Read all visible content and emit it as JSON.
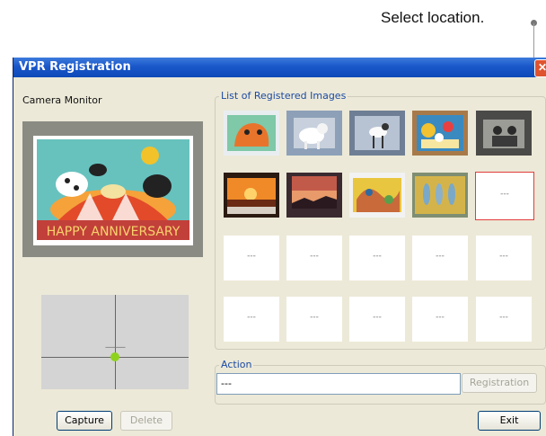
{
  "callout": {
    "text": "Select location."
  },
  "window": {
    "title": "VPR Registration",
    "close_glyph": "✕"
  },
  "camera": {
    "label": "Camera Monitor",
    "marker_text": "-----------"
  },
  "registered": {
    "label": "List of Registered Images",
    "cells": [
      {
        "type": "image",
        "icon": "photo-orange-animal"
      },
      {
        "type": "image",
        "icon": "photo-white-robot"
      },
      {
        "type": "image",
        "icon": "photo-robot-dog"
      },
      {
        "type": "image",
        "icon": "photo-colorful-card"
      },
      {
        "type": "image",
        "icon": "photo-dark-scene"
      },
      {
        "type": "image",
        "icon": "photo-sunset"
      },
      {
        "type": "image",
        "icon": "photo-dusk-sky"
      },
      {
        "type": "image",
        "icon": "photo-yellow-card"
      },
      {
        "type": "image",
        "icon": "photo-birds"
      },
      {
        "type": "empty",
        "text": "---",
        "selected": true
      },
      {
        "type": "empty",
        "text": "---"
      },
      {
        "type": "empty",
        "text": "---"
      },
      {
        "type": "empty",
        "text": "---"
      },
      {
        "type": "empty",
        "text": "---"
      },
      {
        "type": "empty",
        "text": "---"
      },
      {
        "type": "empty",
        "text": "---"
      },
      {
        "type": "empty",
        "text": "---"
      },
      {
        "type": "empty",
        "text": "---"
      },
      {
        "type": "empty",
        "text": "---"
      },
      {
        "type": "empty",
        "text": "---"
      }
    ]
  },
  "action": {
    "label": "Action",
    "value": "---",
    "register_label": "Registration"
  },
  "buttons": {
    "capture": "Capture",
    "delete": "Delete",
    "exit": "Exit"
  },
  "colors": {
    "title_bar": "#1a57c9",
    "selection": "#e23c3c",
    "target_dot": "#8fd21e"
  }
}
